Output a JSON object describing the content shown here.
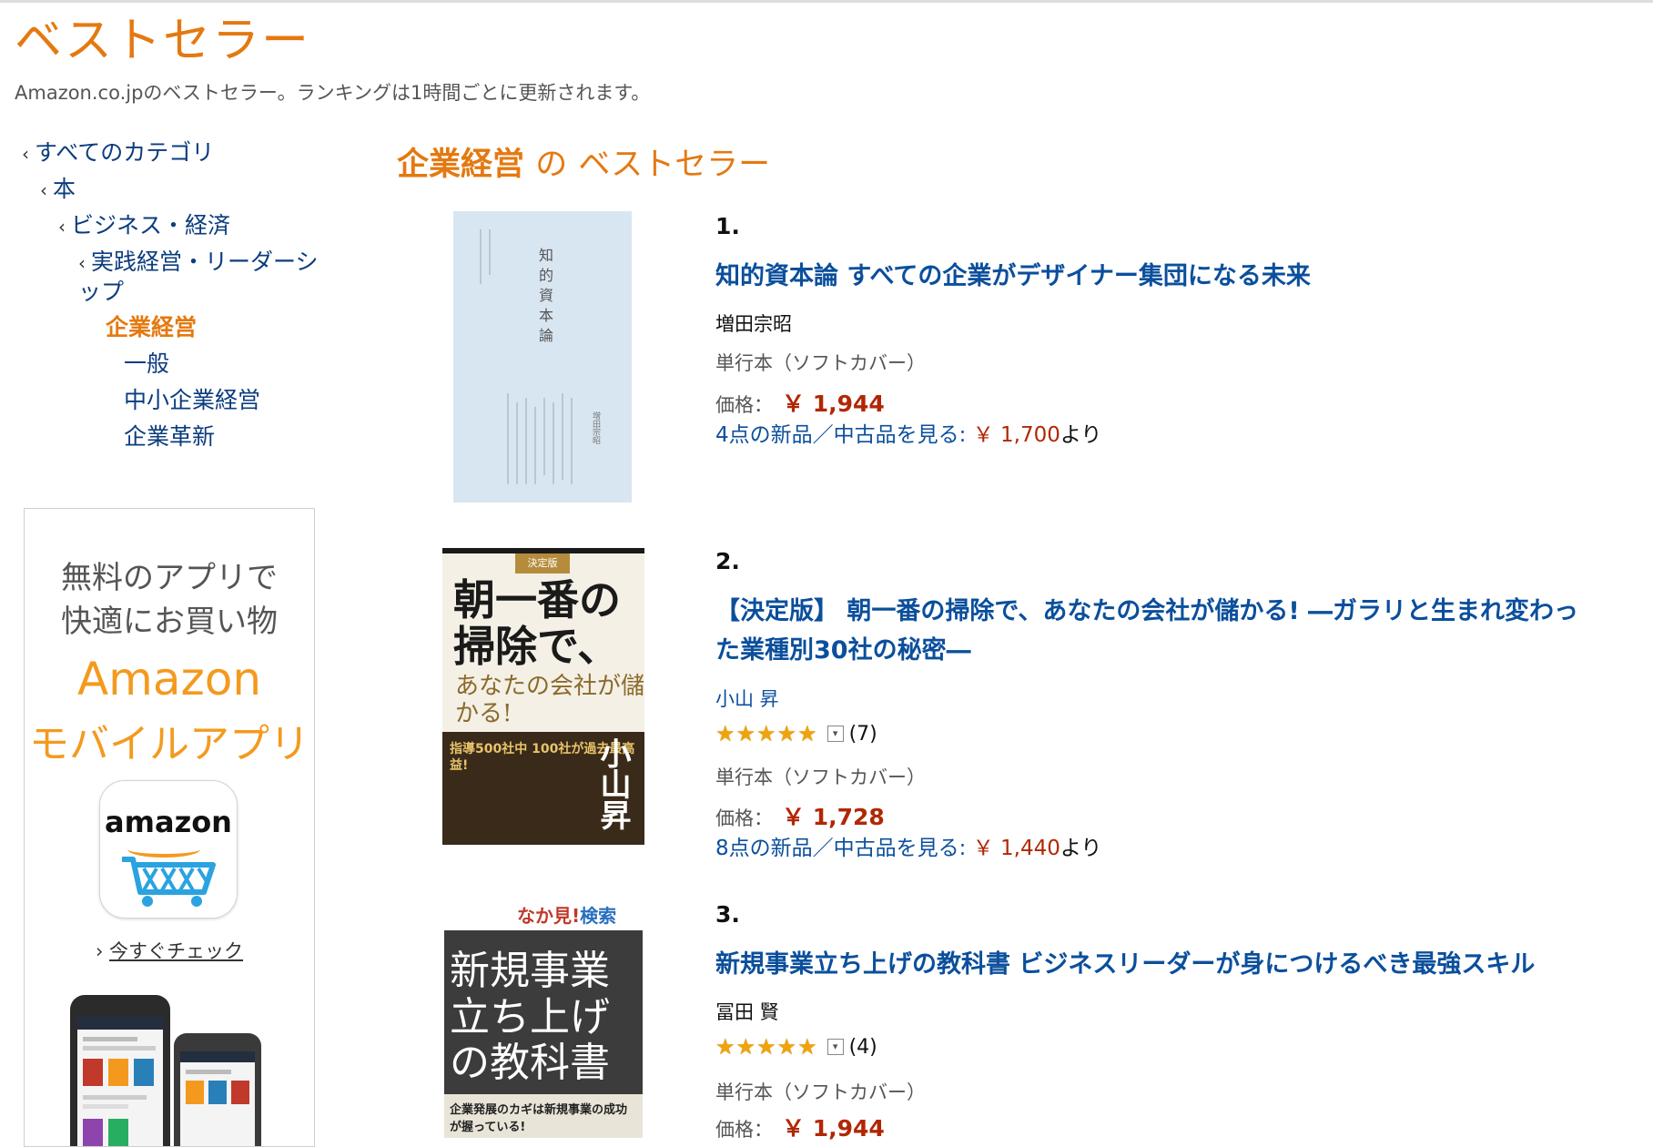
{
  "header": {
    "title": "ベストセラー",
    "subtitle": "Amazon.co.jpのベストセラー。ランキングは1時間ごとに更新されます。"
  },
  "sidebar": {
    "categories": [
      {
        "label": "すべてのカテゴリ",
        "chevron": "‹"
      },
      {
        "label": "本",
        "chevron": "‹"
      },
      {
        "label": "ビジネス・経済",
        "chevron": "‹"
      },
      {
        "label": "実践経営・リーダーシップ",
        "chevron": "‹"
      },
      {
        "label": "企業経営",
        "current": true
      },
      {
        "label": "一般"
      },
      {
        "label": "中小企業経営"
      },
      {
        "label": "企業革新"
      }
    ]
  },
  "ad": {
    "line1": "無料のアプリで",
    "line2": "快適にお買い物",
    "line3": "Amazon",
    "line4": "モバイルアプリ",
    "app_icon_text": "amazon",
    "cta_chevron": "›",
    "cta": "今すぐチェック"
  },
  "main": {
    "section_category": "企業経営",
    "section_connector": "の",
    "section_suffix": "ベストセラー",
    "products": [
      {
        "rank": "1.",
        "title": "知的資本論 すべての企業がデザイナー集団になる未来",
        "author": "増田宗昭",
        "author_is_link": false,
        "format": "単行本（ソフトカバー）",
        "price_label": "価格：",
        "price": "￥ 1,944",
        "offers_text": "4点の新品／中古品を見る:",
        "offers_price": "￥ 1,700",
        "offers_suffix": "より"
      },
      {
        "rank": "2.",
        "title": "【決定版】 朝一番の掃除で、あなたの会社が儲かる! ―ガラリと生まれ変わった業種別30社の秘密―",
        "author": "小山 昇",
        "author_is_link": true,
        "rating_stars": "★★★★★",
        "review_count": "(7)",
        "format": "単行本（ソフトカバー）",
        "price_label": "価格：",
        "price": "￥ 1,728",
        "offers_text": "8点の新品／中古品を見る:",
        "offers_price": "￥ 1,440",
        "offers_suffix": "より"
      },
      {
        "rank": "3.",
        "title": "新規事業立ち上げの教科書 ビジネスリーダーが身につけるべき最強スキル",
        "author": "冨田 賢",
        "author_is_link": false,
        "rating_stars": "★★★★★",
        "review_count": "(4)",
        "format": "単行本（ソフトカバー）",
        "price_label": "価格：",
        "price": "￥ 1,944"
      }
    ]
  },
  "covers": {
    "c1_title": "知的資本論",
    "c1_author": "増田宗昭",
    "c2_tab": "決定版",
    "c2_title": "朝一番の掃除で、",
    "c2_sub": "あなたの会社が儲かる!",
    "c2_band": "指導500社中 100社が過去最高益!",
    "c2_author": "小山昇",
    "c3_top_a": "なか見!",
    "c3_top_b": "検索",
    "c3_title": "新規事業立ち上げの教科書",
    "c3_bar": "企業発展のカギは新規事業の成功が握っている!"
  },
  "colors": {
    "accent_orange": "#e47911",
    "link_blue": "#0b4f9c",
    "price_red": "#b12704",
    "star_gold": "#f0a30a"
  }
}
